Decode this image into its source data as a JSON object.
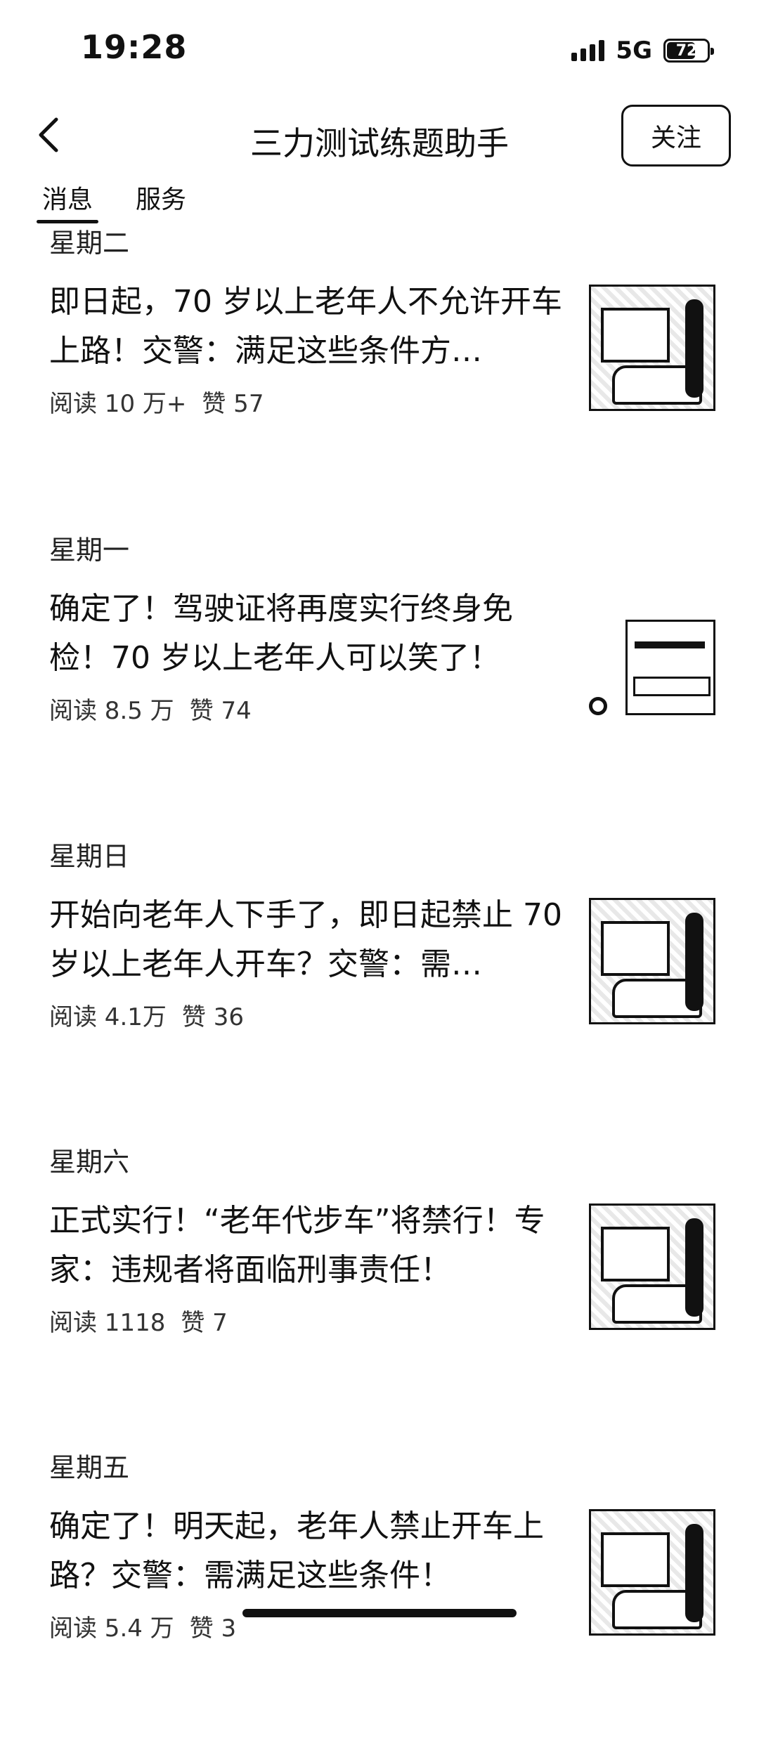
{
  "status_bar": {
    "time": "19:28",
    "network": "5G",
    "battery": "72",
    "battery_level": 0.72,
    "signal_bars": 4
  },
  "nav": {
    "back_icon": "chevron-left-icon",
    "title": "三力测试练题助手",
    "follow_label": "关注"
  },
  "tabs": {
    "messages": "消息",
    "services": "服务",
    "active": "messages"
  },
  "feed": [
    {
      "day": "星期二",
      "title": "即日起，70 岁以上老年人不允许开车上路！交警：满足这些条件方…",
      "reads": "阅读 10 万+",
      "likes": "赞 57",
      "thumb": "photo"
    },
    {
      "day": "星期一",
      "title": "确定了！驾驶证将再度实行终身免检！70 岁以上老年人可以笑了！",
      "reads": "阅读 8.5 万",
      "likes": "赞 74",
      "thumb": "document"
    },
    {
      "day": "星期日",
      "title": "开始向老年人下手了，即日起禁止 70 岁以上老年人开车？交警：需…",
      "reads": "阅读 4.1万",
      "likes": "赞 36",
      "thumb": "photo"
    },
    {
      "day": "星期六",
      "title": "正式实行！“老年代步车”将禁行！专家：违规者将面临刑事责任！",
      "reads": "阅读 1118",
      "likes": "赞 7",
      "thumb": "photo"
    },
    {
      "day": "星期五",
      "title": "确定了！明天起，老年人禁止开车上路？交警：需满足这些条件！",
      "reads": "阅读 5.4 万",
      "likes": "赞 3",
      "thumb": "photo"
    }
  ]
}
